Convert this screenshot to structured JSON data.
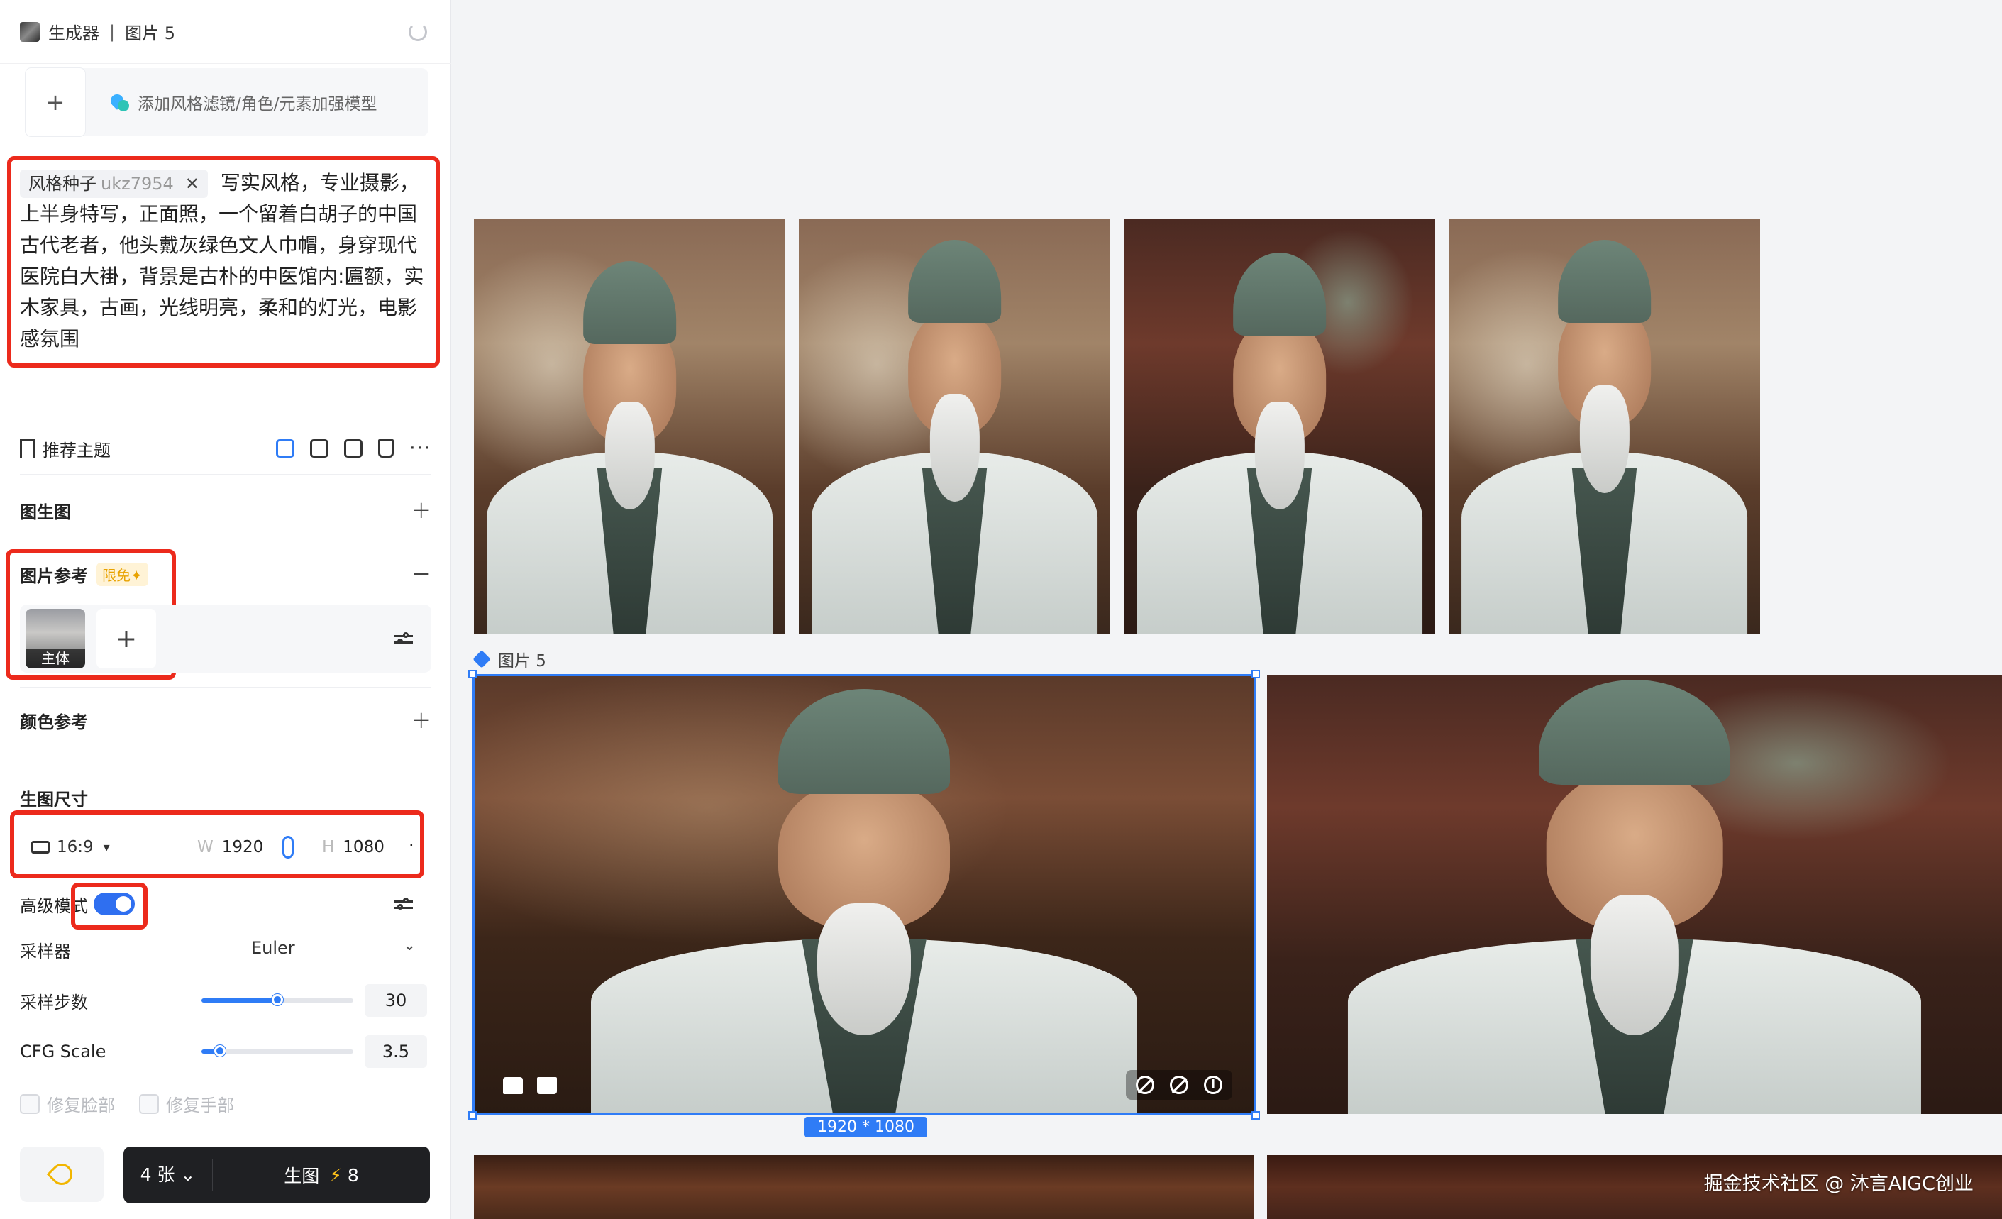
{
  "header": {
    "app_name": "生成器",
    "separator": "|",
    "document_title": "图片 5"
  },
  "style_add": {
    "plus": "+",
    "label": "添加风格滤镜/角色/元素加强模型"
  },
  "prompt": {
    "seed_chip_label": "风格种子",
    "seed_chip_code": "ukz7954",
    "seed_chip_close": "✕",
    "text": "写实风格，专业摄影，上半身特写，正面照，一个留着白胡子的中国古代老者，他头戴灰绿色文人巾帽，身穿现代医院白大褂，背景是古朴的中医馆内:匾额，实木家具，古画，光线明亮，柔和的灯光，电影感氛围"
  },
  "recommend": {
    "label": "推荐主题",
    "more": "···"
  },
  "img2img": {
    "label": "图生图",
    "action": "+"
  },
  "image_ref": {
    "label": "图片参考",
    "badge": "限免✦",
    "action": "−",
    "thumb_tag": "主体",
    "add": "+"
  },
  "color_ref": {
    "label": "颜色参考",
    "action": "+"
  },
  "size": {
    "label": "生图尺寸",
    "ratio": "16:9",
    "width_prefix": "W",
    "width": "1920",
    "height_prefix": "H",
    "height": "1080",
    "overflow": "·"
  },
  "advanced": {
    "label": "高级模式",
    "enabled": true
  },
  "sampler": {
    "label": "采样器",
    "value": "Euler",
    "chevron": "⌄"
  },
  "steps": {
    "label": "采样步数",
    "value": "30",
    "fill_fraction": 0.5
  },
  "cfg": {
    "label": "CFG Scale",
    "value": "3.5",
    "fill_fraction": 0.12
  },
  "fixes": {
    "face": "修复脸部",
    "hand": "修复手部"
  },
  "footer": {
    "count": "4 张",
    "count_chevron": "⌄",
    "generate": "生图",
    "bolt": "⚡",
    "cost": "8"
  },
  "canvas": {
    "image_label": "图片 5",
    "size_badge": "1920 * 1080",
    "watermark": "掘金技术社区 @ 沐言AIGC创业"
  },
  "colors": {
    "accent_blue": "#2f7cf6",
    "highlight_red": "#ec2a1c",
    "button_dark": "#1f2023"
  }
}
